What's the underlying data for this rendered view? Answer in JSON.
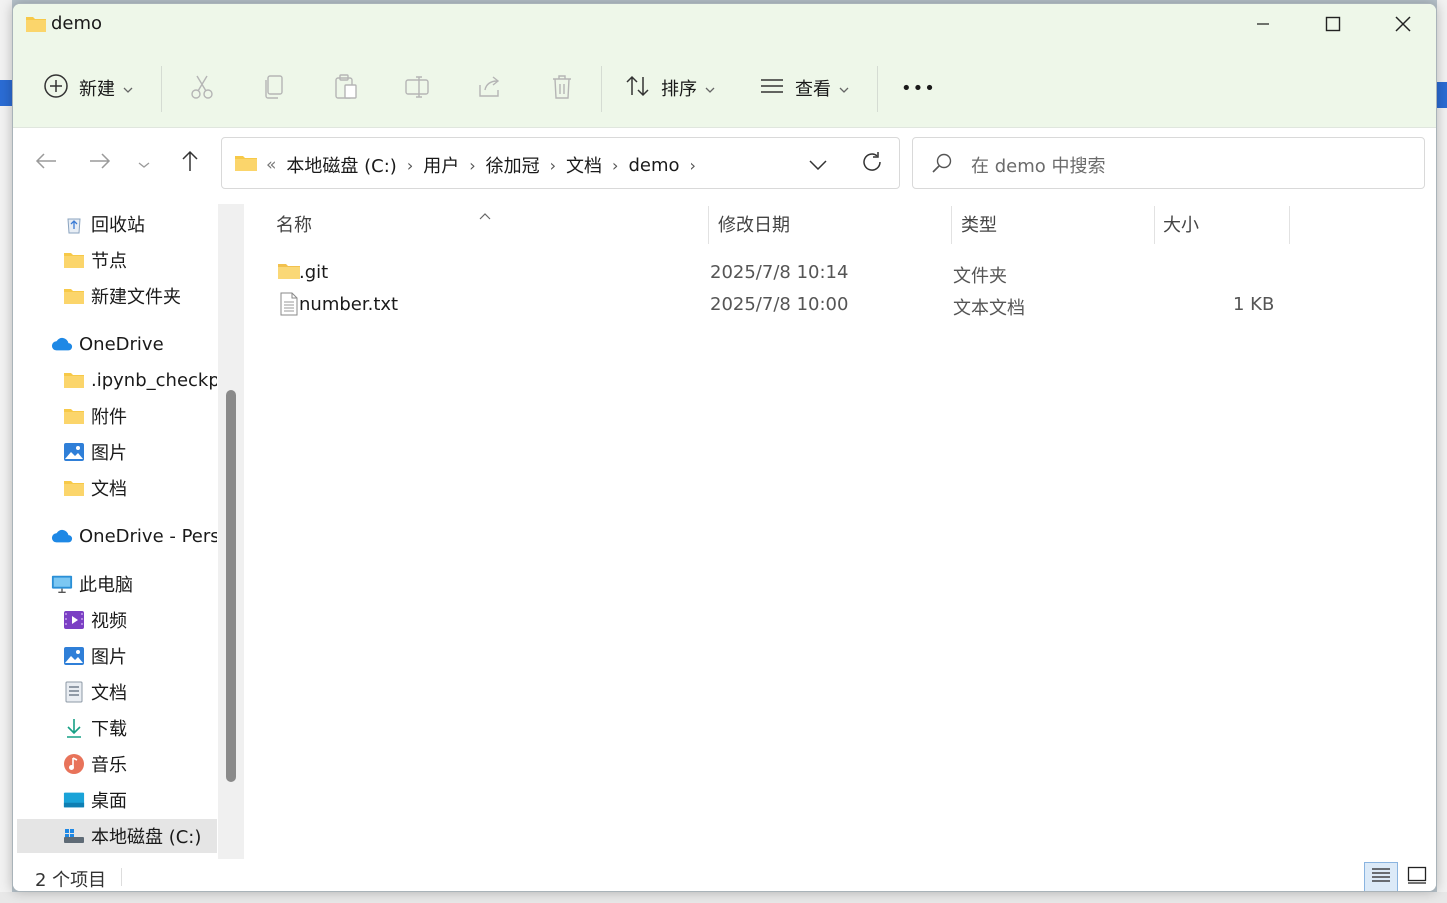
{
  "window": {
    "title": "demo"
  },
  "toolbar": {
    "new_label": "新建",
    "sort_label": "排序",
    "view_label": "查看",
    "more_label": "•••"
  },
  "address": {
    "overflow": "«",
    "crumbs": [
      "本地磁盘 (C:)",
      "用户",
      "徐加冠",
      "文档",
      "demo"
    ]
  },
  "search": {
    "placeholder": "在 demo 中搜索"
  },
  "sidebar": {
    "quick_access": [
      {
        "label": "回收站",
        "icon": "recycle-bin-icon",
        "pinned": true
      },
      {
        "label": "节点",
        "icon": "folder-icon",
        "pinned": true
      },
      {
        "label": "新建文件夹",
        "icon": "folder-icon",
        "pinned": true
      }
    ],
    "onedrive": {
      "label": "OneDrive",
      "icon": "cloud-icon"
    },
    "onedrive_items": [
      {
        "label": ".ipynb_checkpoints",
        "icon": "folder-icon"
      },
      {
        "label": "附件",
        "icon": "folder-icon"
      },
      {
        "label": "图片",
        "icon": "pictures-icon"
      },
      {
        "label": "文档",
        "icon": "folder-icon"
      }
    ],
    "onedrive_personal": {
      "label": "OneDrive - Personal",
      "icon": "cloud-icon"
    },
    "this_pc": {
      "label": "此电脑",
      "icon": "computer-icon"
    },
    "pc_items": [
      {
        "label": "视频",
        "icon": "videos-icon"
      },
      {
        "label": "图片",
        "icon": "pictures-icon"
      },
      {
        "label": "文档",
        "icon": "documents-icon"
      },
      {
        "label": "下载",
        "icon": "download-icon"
      },
      {
        "label": "音乐",
        "icon": "music-icon"
      },
      {
        "label": "桌面",
        "icon": "desktop-icon"
      },
      {
        "label": "本地磁盘 (C:)",
        "icon": "drive-icon",
        "selected": true
      }
    ]
  },
  "columns": {
    "name": "名称",
    "modified": "修改日期",
    "type": "类型",
    "size": "大小"
  },
  "files": [
    {
      "name": ".git",
      "modified": "2025/7/8 10:14",
      "type": "文件夹",
      "size": "",
      "icon": "folder-icon"
    },
    {
      "name": "number.txt",
      "modified": "2025/7/8 10:00",
      "type": "文本文档",
      "size": "1 KB",
      "icon": "text-file-icon"
    }
  ],
  "status": {
    "item_count": "2 个项目"
  },
  "colors": {
    "header_bg": "#eef7e9",
    "folder": "#f7c948",
    "accent": "#0067c0"
  }
}
